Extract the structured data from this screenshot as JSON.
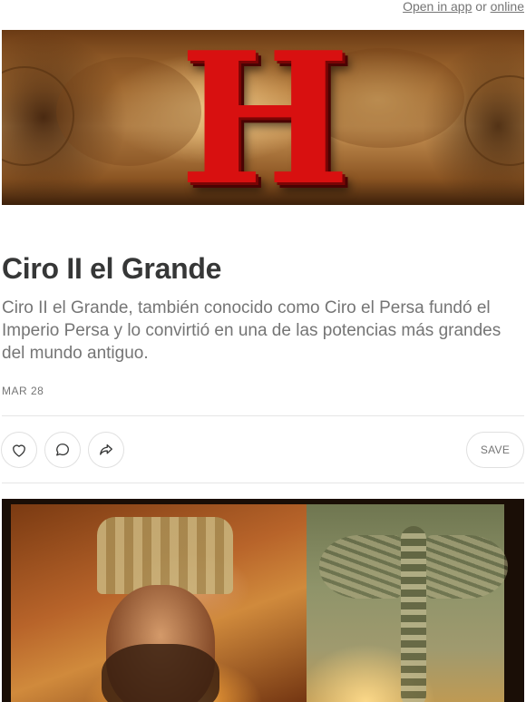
{
  "header": {
    "open_in_app_label": "Open in app",
    "or_label": " or ",
    "online_label": "online"
  },
  "banner": {
    "letter": "H",
    "colors": {
      "letter": "#d81010"
    }
  },
  "post": {
    "title": "Ciro II el Grande",
    "subtitle": "Ciro II el Grande, también conocido como Ciro el Persa fundó el Imperio Persa y lo convirtió en una de las potencias más grandes del mundo antiguo.",
    "date": "MAR 28"
  },
  "actions": {
    "like_icon": "heart-icon",
    "comment_icon": "comment-icon",
    "share_icon": "share-icon",
    "save_label": "SAVE"
  }
}
